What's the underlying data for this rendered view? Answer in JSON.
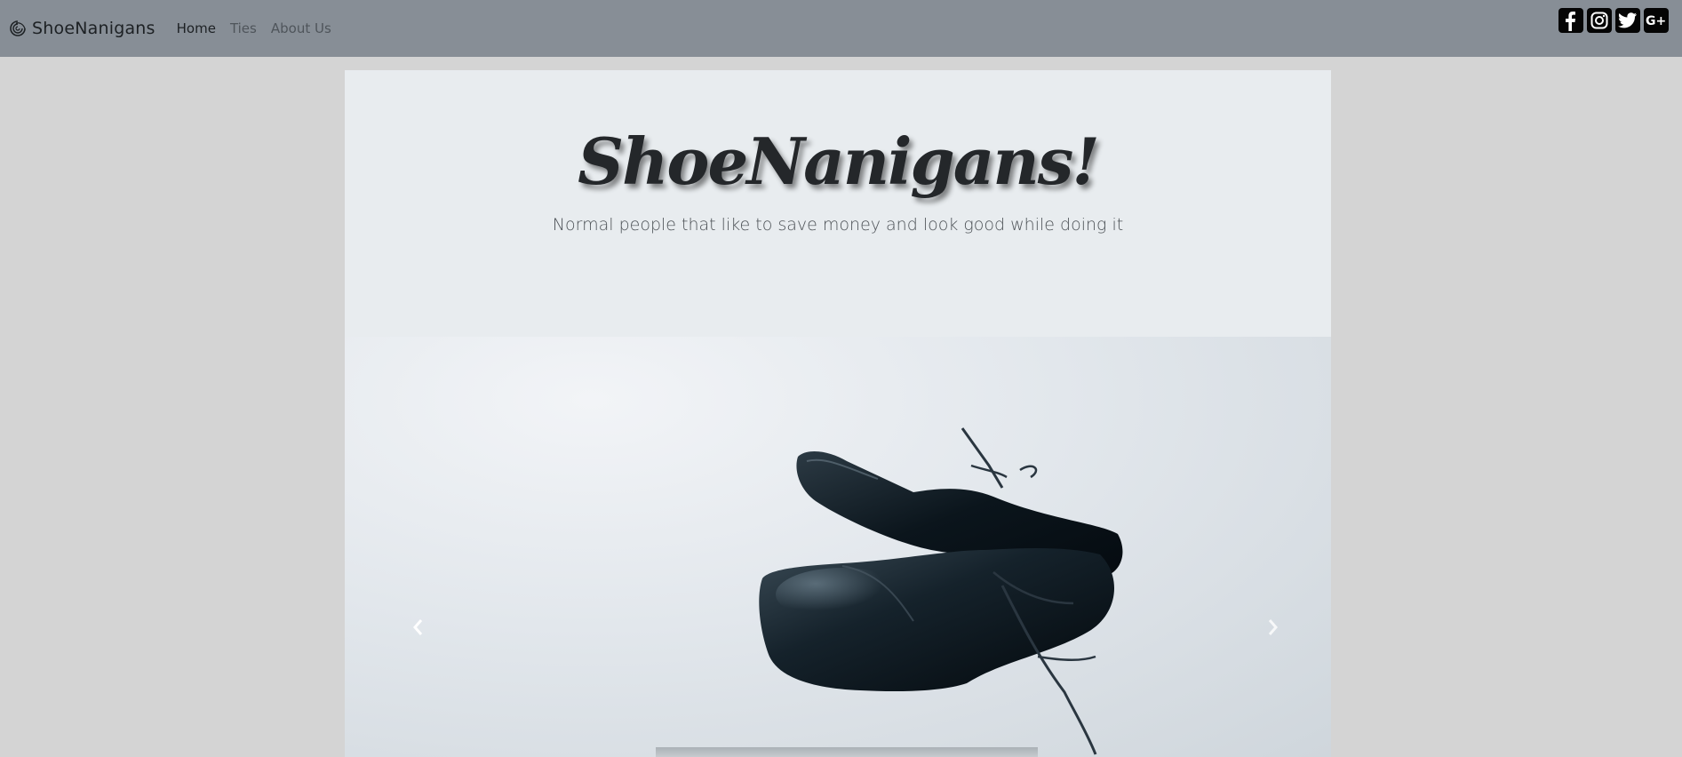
{
  "navbar": {
    "brand_icon": "swirl-logo-icon",
    "brand": "ShoeNanigans",
    "links": [
      {
        "label": "Home",
        "active": true
      },
      {
        "label": "Ties",
        "active": false
      },
      {
        "label": "About Us",
        "active": false
      }
    ],
    "social_icons": [
      "facebook-icon",
      "instagram-icon",
      "twitter-icon",
      "google-plus-icon"
    ],
    "background": "#878e96"
  },
  "jumbotron": {
    "title": "ShoeNanigans!",
    "subtitle": "Normal people that like to save money and look good while doing it",
    "background": "#e8ecef"
  },
  "carousel": {
    "image_icon": "dress-shoes-image",
    "prev_icon": "chevron-left-icon",
    "next_icon": "chevron-right-icon"
  },
  "page_background": "#d4d4d4"
}
